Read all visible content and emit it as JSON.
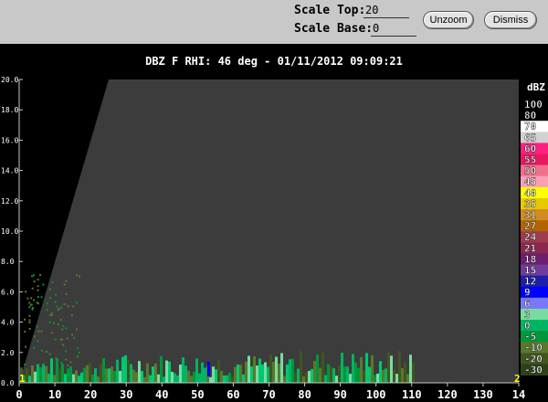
{
  "toolbar": {
    "scale_top_label": "Scale Top:",
    "scale_top_value": "20",
    "scale_base_label": "Scale Base:",
    "scale_base_value": "0",
    "unzoom_label": "Unzoom",
    "dismiss_label": "Dismiss"
  },
  "plot": {
    "title": "DBZ F  RHI: 46 deg  -  01/11/2012 09:09:21",
    "corner_left": "1",
    "corner_right": "2"
  },
  "chart_data": {
    "type": "heatmap",
    "title": "DBZ F  RHI: 46 deg  -  01/11/2012 09:09:21",
    "x_ticks": [
      "0",
      "10",
      "20",
      "30",
      "40",
      "50",
      "60",
      "70",
      "80",
      "90",
      "100",
      "110",
      "120",
      "130",
      "14"
    ],
    "y_ticks": [
      "0.0",
      "2.0",
      "4.0",
      "6.0",
      "8.0",
      "10.0",
      "12.0",
      "14.0",
      "16.0",
      "18.0",
      "20.0"
    ],
    "xlim": [
      0,
      140
    ],
    "ylim": [
      0,
      20
    ],
    "colorbar": {
      "label": "dBZ",
      "levels": [
        "100",
        "80",
        "70",
        "65",
        "60",
        "55",
        "50",
        "45",
        "40",
        "35",
        "31",
        "27",
        "24",
        "21",
        "18",
        "15",
        "12",
        "9",
        "6",
        "3",
        "0",
        "-5",
        "-10",
        "-20",
        "-30"
      ],
      "colors": [
        "#000000",
        "#000000",
        "#ffffff",
        "#d2d2d2",
        "#ff2080",
        "#e81860",
        "#f0708c",
        "#f8a0b4",
        "#ffff00",
        "#e8c800",
        "#d08c20",
        "#b46400",
        "#a03c50",
        "#8c2850",
        "#6e1e6e",
        "#6e3c9c",
        "#1e1eaa",
        "#0000ff",
        "#7878ff",
        "#78dca0",
        "#00b464",
        "#00963c",
        "#5a782d",
        "#41551e",
        "#2d4119"
      ]
    }
  }
}
